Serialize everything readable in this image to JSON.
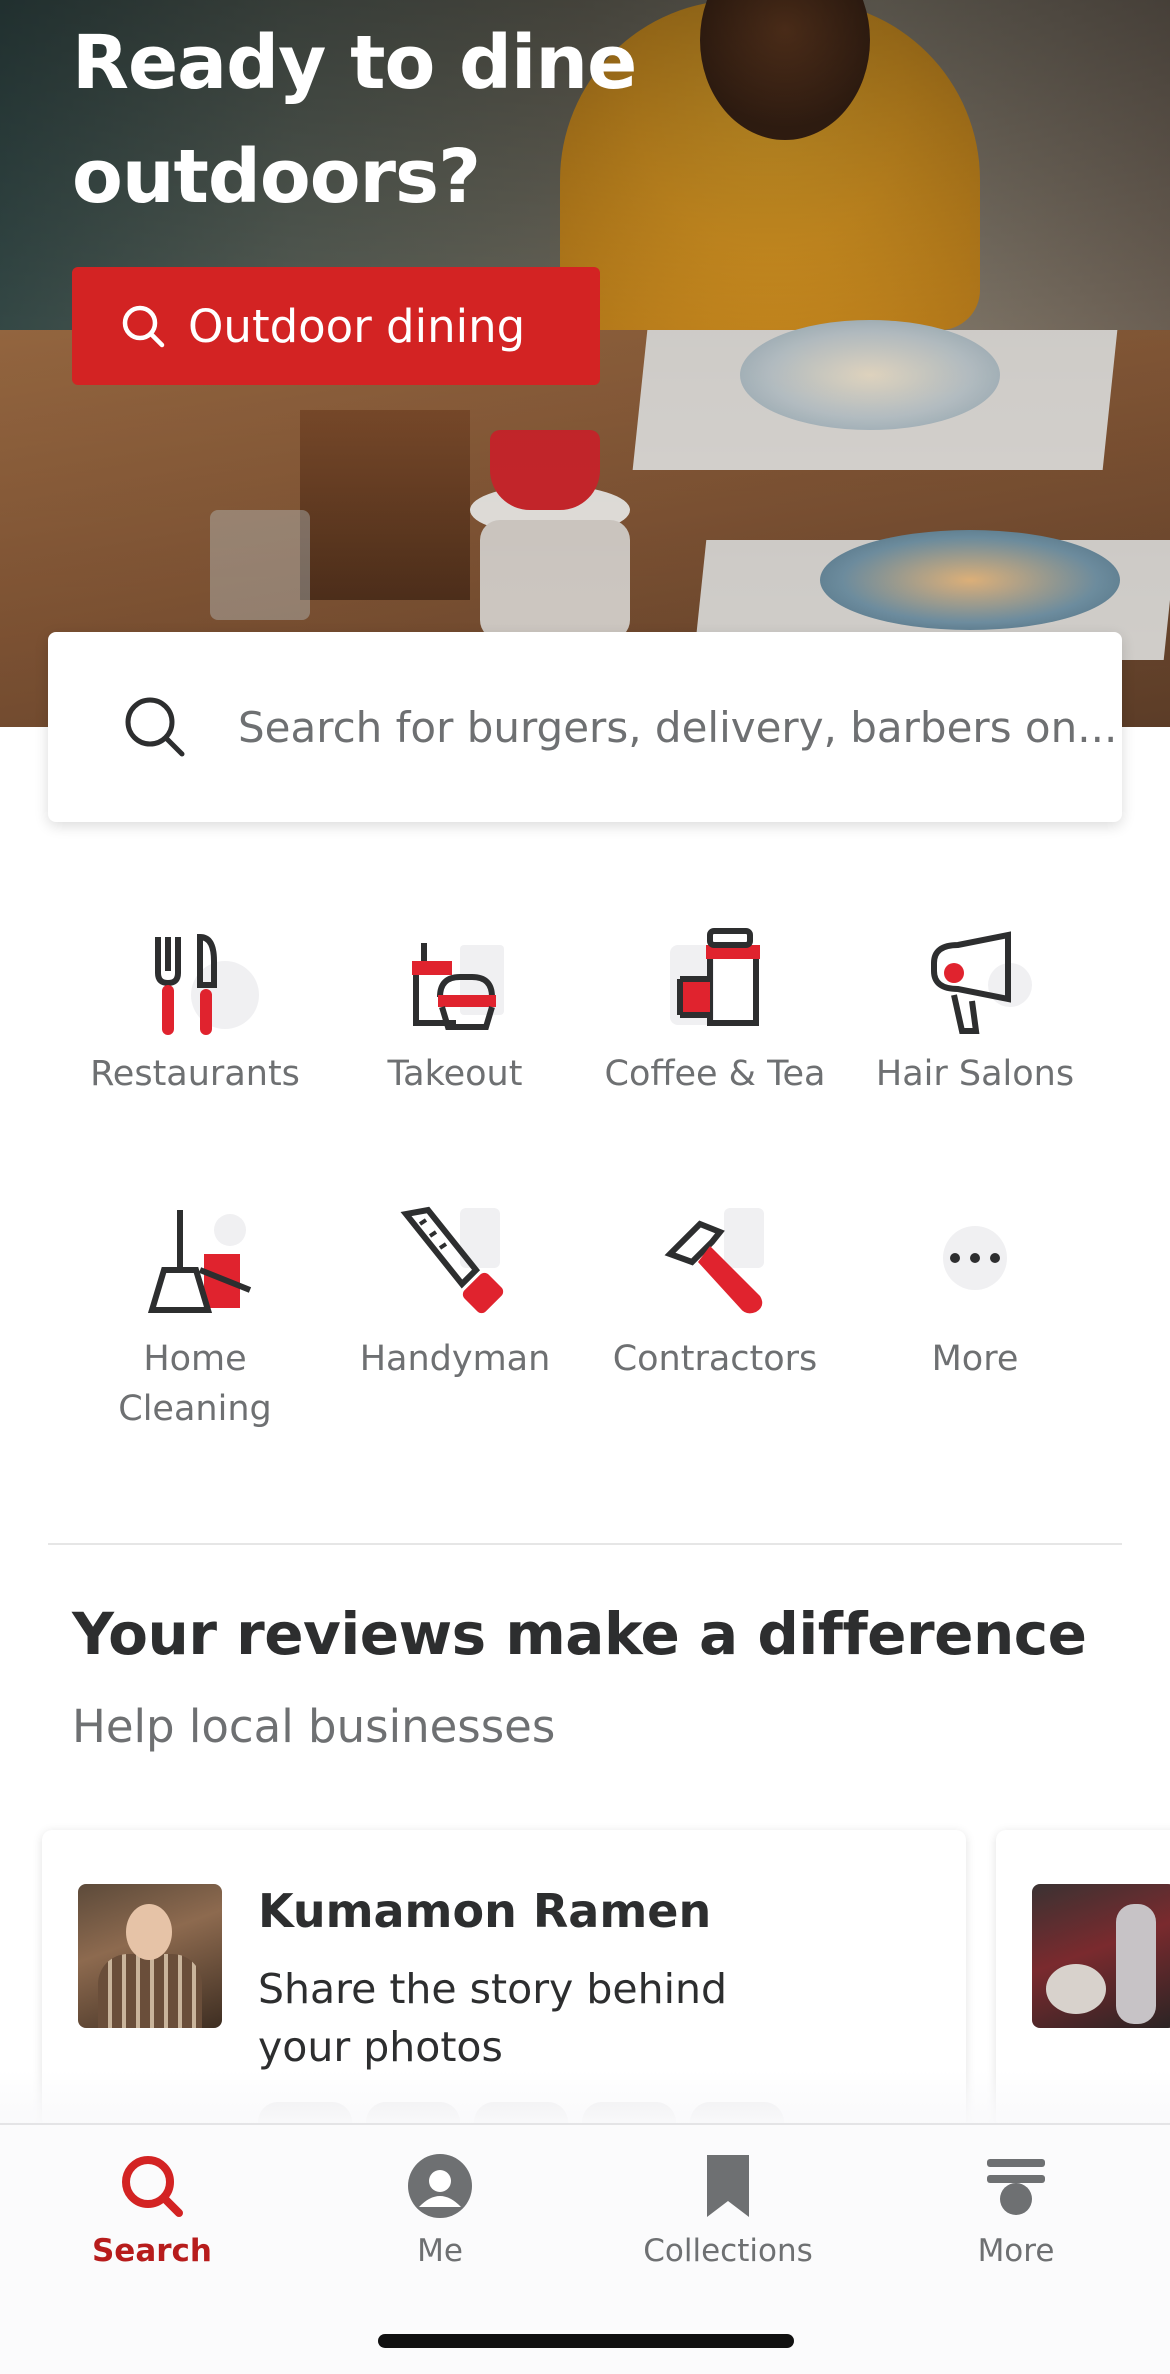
{
  "hero": {
    "title": "Ready to dine outdoors?",
    "button_label": "Outdoor dining"
  },
  "search": {
    "placeholder": "Search for burgers, delivery, barbers on..."
  },
  "categories": [
    {
      "label": "Restaurants",
      "icon": "fork-knife-icon"
    },
    {
      "label": "Takeout",
      "icon": "takeout-basket-icon"
    },
    {
      "label": "Coffee & Tea",
      "icon": "coffee-cup-icon"
    },
    {
      "label": "Hair Salons",
      "icon": "hair-dryer-icon"
    },
    {
      "label": "Home Cleaning",
      "icon": "broom-icon"
    },
    {
      "label": "Handyman",
      "icon": "saw-icon"
    },
    {
      "label": "Contractors",
      "icon": "hammer-icon"
    },
    {
      "label": "More",
      "icon": "more-dots-icon"
    }
  ],
  "reviews_section": {
    "title": "Your reviews make a difference",
    "subtitle": "Help local businesses",
    "cards": [
      {
        "business": "Kumamon Ramen",
        "prompt": "Share the story behind your photos"
      }
    ]
  },
  "bottom_nav": {
    "items": [
      {
        "label": "Search",
        "icon": "search-icon",
        "active": true
      },
      {
        "label": "Me",
        "icon": "profile-icon",
        "active": false
      },
      {
        "label": "Collections",
        "icon": "bookmark-icon",
        "active": false
      },
      {
        "label": "More",
        "icon": "menu-icon",
        "active": false
      }
    ]
  },
  "colors": {
    "brand_red": "#d32323",
    "active_nav": "#b71c1c",
    "text_primary": "#2d2e2f",
    "text_secondary": "#6e7072"
  }
}
